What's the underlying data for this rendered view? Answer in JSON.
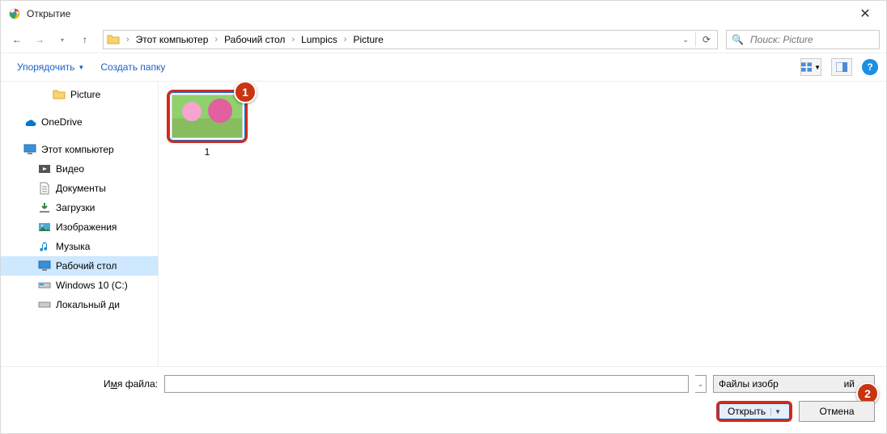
{
  "title": "Открытие",
  "breadcrumb": {
    "root": "Этот компьютер",
    "seg1": "Рабочий стол",
    "seg2": "Lumpics",
    "seg3": "Picture"
  },
  "search": {
    "placeholder": "Поиск: Picture"
  },
  "toolbar": {
    "organize": "Упорядочить",
    "new_folder": "Создать папку"
  },
  "sidebar": {
    "picture": "Picture",
    "onedrive": "OneDrive",
    "this_pc": "Этот компьютер",
    "video": "Видео",
    "documents": "Документы",
    "downloads": "Загрузки",
    "images": "Изображения",
    "music": "Музыка",
    "desktop": "Рабочий стол",
    "c_drive": "Windows 10 (C:)",
    "local_disk": "Локальный ди"
  },
  "file": {
    "thumb_label": "1"
  },
  "footer": {
    "filename_label_pre": "И",
    "filename_label_u": "м",
    "filename_label_post": "я файла:",
    "filter": "Файлы изобр",
    "filter_suffix": "ий",
    "open": "Открыть",
    "cancel": "Отмена"
  },
  "badges": {
    "one": "1",
    "two": "2"
  }
}
